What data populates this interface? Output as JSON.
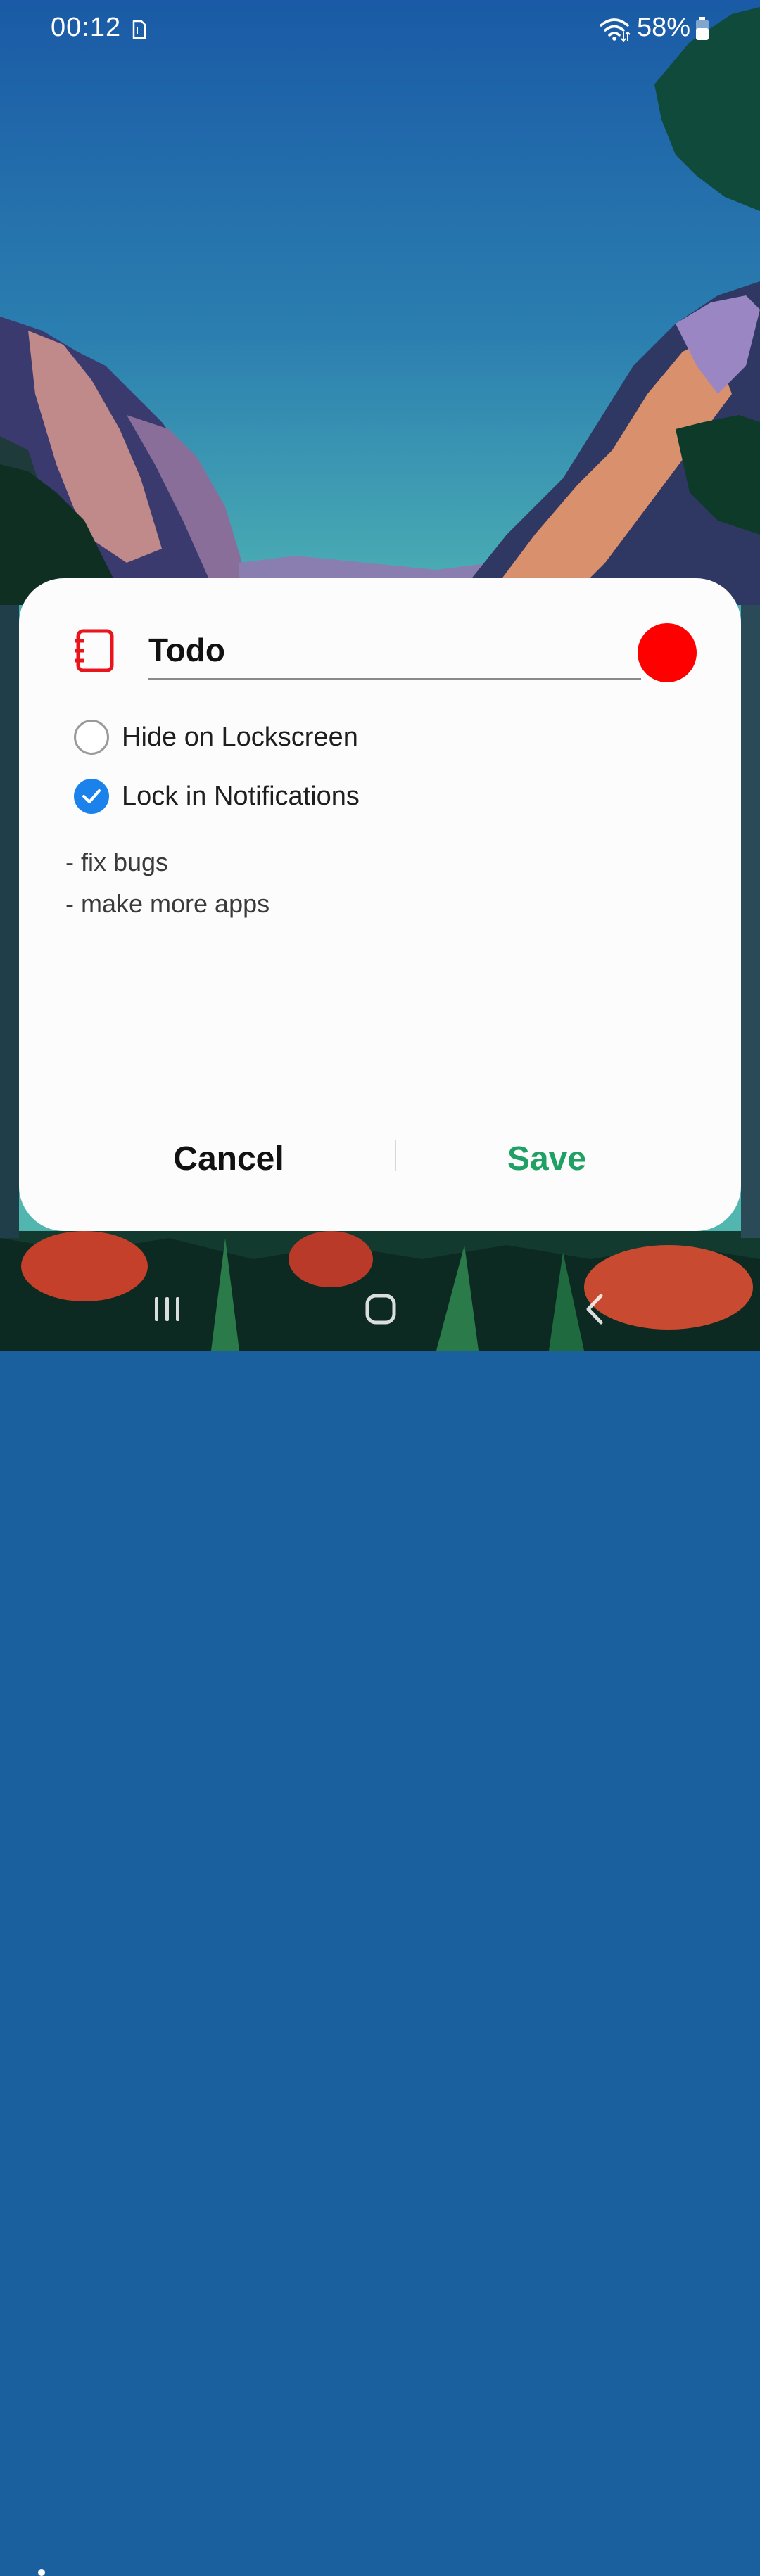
{
  "status_bar": {
    "time": "00:12",
    "battery_percent": "58%",
    "battery_level": 0.58,
    "icons": [
      "sim-card-icon",
      "wifi-icon",
      "battery-icon"
    ]
  },
  "dialog": {
    "title_value": "Todo",
    "icon": "notebook-icon",
    "icon_color": "#e8161c",
    "selected_color": "#ff0000",
    "options": [
      {
        "label": "Hide on Lockscreen",
        "checked": false
      },
      {
        "label": "Lock in Notifications",
        "checked": true
      }
    ],
    "note_lines": [
      "- fix bugs",
      "- make more apps"
    ],
    "cancel_label": "Cancel",
    "save_label": "Save",
    "accent_color": "#1a82ea",
    "save_color": "#1fa064"
  },
  "nav_bar": {
    "icons": [
      "recents-icon",
      "home-icon",
      "back-icon"
    ]
  }
}
